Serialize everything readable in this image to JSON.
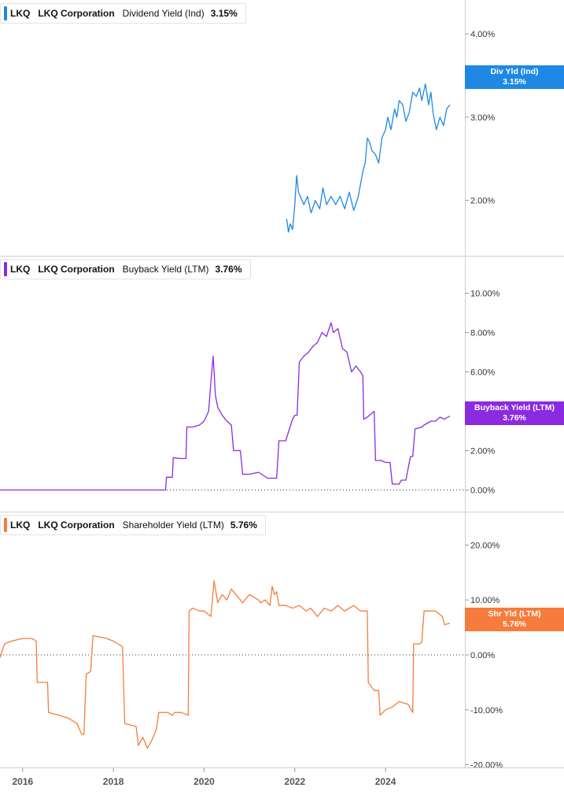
{
  "chart_data": [
    {
      "type": "line",
      "ticker": "LKQ",
      "company": "LKQ Corporation",
      "metric": "Dividend Yield (Ind)",
      "last_value_label": "3.15%",
      "badge": {
        "line1": "Div Yld (Ind)",
        "line2": "3.15%"
      },
      "color": "#1e88e5",
      "ylim": [
        1.6,
        4.2
      ],
      "yticks": [
        2.0,
        3.0,
        4.0
      ],
      "ytick_labels": [
        "2.00%",
        "3.00%",
        "4.00%"
      ],
      "zero_line": false,
      "series": [
        {
          "x": [
            2021.82,
            2021.86,
            2021.9,
            2021.95,
            2022.0,
            2022.04,
            2022.08,
            2022.12,
            2022.2,
            2022.28,
            2022.36,
            2022.45,
            2022.55,
            2022.62,
            2022.7,
            2022.8,
            2022.9,
            2023.0,
            2023.1,
            2023.2,
            2023.3,
            2023.4,
            2023.45,
            2023.5,
            2023.55,
            2023.6,
            2023.65,
            2023.7,
            2023.78,
            2023.85,
            2023.92,
            2024.0,
            2024.05,
            2024.12,
            2024.2,
            2024.25,
            2024.3,
            2024.38,
            2024.45,
            2024.52,
            2024.6,
            2024.68,
            2024.75,
            2024.8,
            2024.88,
            2024.95,
            2025.0,
            2025.05,
            2025.12,
            2025.2,
            2025.28,
            2025.35,
            2025.42
          ],
          "values": [
            1.78,
            1.62,
            1.72,
            1.65,
            1.95,
            2.3,
            2.1,
            2.05,
            1.95,
            2.05,
            1.85,
            2.0,
            1.9,
            2.15,
            1.95,
            2.05,
            1.95,
            2.05,
            1.9,
            2.1,
            1.88,
            2.05,
            2.2,
            2.35,
            2.45,
            2.75,
            2.7,
            2.6,
            2.55,
            2.45,
            2.75,
            2.85,
            3.0,
            2.85,
            3.1,
            3.0,
            3.2,
            3.15,
            2.95,
            3.05,
            3.3,
            3.25,
            3.35,
            3.2,
            3.4,
            3.15,
            3.3,
            3.05,
            2.85,
            3.0,
            2.9,
            3.1,
            3.15
          ]
        }
      ]
    },
    {
      "type": "line",
      "ticker": "LKQ",
      "company": "LKQ Corporation",
      "metric": "Buyback Yield (LTM)",
      "last_value_label": "3.76%",
      "badge": {
        "line1": "Buyback Yield (LTM)",
        "line2": "3.76%"
      },
      "color": "#8a2be2",
      "ylim": [
        -0.3,
        10.5
      ],
      "yticks": [
        0,
        2,
        4,
        6,
        8,
        10
      ],
      "ytick_labels": [
        "0.00%",
        "2.00%",
        "4.00%",
        "6.00%",
        "8.00%",
        "10.00%"
      ],
      "zero_line": true,
      "series": [
        {
          "x": [
            2015.5,
            2016.0,
            2016.5,
            2017.0,
            2017.5,
            2018.0,
            2018.5,
            2019.0,
            2019.15,
            2019.17,
            2019.3,
            2019.32,
            2019.45,
            2019.6,
            2019.62,
            2019.75,
            2019.9,
            2020.0,
            2020.1,
            2020.15,
            2020.2,
            2020.25,
            2020.3,
            2020.4,
            2020.5,
            2020.6,
            2020.65,
            2020.8,
            2020.85,
            2021.0,
            2021.2,
            2021.4,
            2021.45,
            2021.6,
            2021.65,
            2021.8,
            2021.95,
            2022.0,
            2022.05,
            2022.1,
            2022.2,
            2022.3,
            2022.4,
            2022.5,
            2022.6,
            2022.7,
            2022.8,
            2022.85,
            2022.95,
            2023.05,
            2023.15,
            2023.25,
            2023.35,
            2023.45,
            2023.5,
            2023.52,
            2023.6,
            2023.75,
            2023.78,
            2023.9,
            2024.0,
            2024.1,
            2024.15,
            2024.3,
            2024.35,
            2024.45,
            2024.55,
            2024.6,
            2024.65,
            2024.8,
            2024.85,
            2025.0,
            2025.1,
            2025.2,
            2025.3,
            2025.42
          ],
          "values": [
            0.0,
            0.0,
            0.0,
            0.0,
            0.0,
            0.0,
            0.0,
            0.0,
            0.0,
            0.65,
            0.65,
            1.65,
            1.6,
            1.6,
            3.2,
            3.2,
            3.3,
            3.5,
            4.0,
            5.5,
            6.8,
            4.8,
            4.2,
            3.8,
            3.5,
            3.3,
            2.0,
            2.0,
            0.8,
            0.8,
            0.9,
            0.6,
            0.6,
            0.6,
            2.5,
            2.5,
            3.6,
            3.8,
            3.8,
            6.5,
            6.8,
            7.0,
            7.3,
            7.5,
            8.0,
            7.8,
            8.5,
            8.0,
            8.2,
            7.2,
            7.0,
            6.0,
            6.3,
            6.0,
            5.8,
            3.6,
            3.7,
            4.0,
            1.5,
            1.5,
            1.4,
            1.4,
            0.3,
            0.3,
            0.5,
            0.5,
            1.7,
            1.7,
            3.1,
            3.2,
            3.3,
            3.5,
            3.5,
            3.7,
            3.6,
            3.76
          ]
        }
      ]
    },
    {
      "type": "line",
      "ticker": "LKQ",
      "company": "LKQ Corporation",
      "metric": "Shareholder Yield (LTM)",
      "last_value_label": "5.76%",
      "badge": {
        "line1": "Shr Yld (LTM)",
        "line2": "5.76%"
      },
      "color": "#f57c3c",
      "ylim": [
        -20.5,
        21.5
      ],
      "yticks": [
        -20,
        -10,
        0,
        10,
        20
      ],
      "ytick_labels": [
        "-20.00%",
        "-10.00%",
        "0.00%",
        "10.00%",
        "20.00%"
      ],
      "zero_line": true,
      "series": [
        {
          "x": [
            2015.5,
            2015.6,
            2015.75,
            2016.0,
            2016.2,
            2016.3,
            2016.32,
            2016.55,
            2016.57,
            2016.8,
            2017.0,
            2017.2,
            2017.3,
            2017.35,
            2017.4,
            2017.5,
            2017.55,
            2017.85,
            2018.0,
            2018.2,
            2018.25,
            2018.5,
            2018.55,
            2018.65,
            2018.7,
            2018.75,
            2018.85,
            2018.95,
            2019.0,
            2019.1,
            2019.2,
            2019.3,
            2019.35,
            2019.5,
            2019.65,
            2019.67,
            2019.75,
            2019.9,
            2020.0,
            2020.15,
            2020.22,
            2020.3,
            2020.4,
            2020.5,
            2020.6,
            2020.75,
            2020.85,
            2021.0,
            2021.2,
            2021.25,
            2021.35,
            2021.45,
            2021.5,
            2021.55,
            2021.6,
            2021.65,
            2021.8,
            2021.95,
            2022.1,
            2022.25,
            2022.35,
            2022.5,
            2022.65,
            2022.8,
            2022.95,
            2023.1,
            2023.3,
            2023.45,
            2023.55,
            2023.6,
            2023.62,
            2023.75,
            2023.85,
            2023.88,
            2024.0,
            2024.15,
            2024.3,
            2024.5,
            2024.6,
            2024.62,
            2024.75,
            2024.8,
            2024.85,
            2024.95,
            2025.1,
            2025.25,
            2025.3,
            2025.42
          ],
          "values": [
            -0.5,
            2.0,
            2.5,
            3.0,
            3.0,
            2.5,
            -5.0,
            -5.0,
            -10.5,
            -11.0,
            -11.5,
            -12.5,
            -14.5,
            -14.5,
            -3.5,
            -3.0,
            3.5,
            3.0,
            2.5,
            1.5,
            -12.5,
            -13.0,
            -16.5,
            -15.0,
            -16.0,
            -17.0,
            -15.5,
            -13.5,
            -10.5,
            -10.5,
            -10.5,
            -11.0,
            -10.5,
            -10.5,
            -11.0,
            8.0,
            8.5,
            8.0,
            8.0,
            7.0,
            13.5,
            9.5,
            11.0,
            10.0,
            12.0,
            10.5,
            9.5,
            11.0,
            10.0,
            9.5,
            10.0,
            9.0,
            12.5,
            11.0,
            11.5,
            9.0,
            9.0,
            8.5,
            9.0,
            8.0,
            8.5,
            7.0,
            8.5,
            8.0,
            9.0,
            8.0,
            9.0,
            8.0,
            8.0,
            8.0,
            -5.0,
            -6.5,
            -6.5,
            -11.0,
            -10.0,
            -9.5,
            -8.5,
            -9.0,
            -10.5,
            2.0,
            2.0,
            2.3,
            8.0,
            8.0,
            8.0,
            7.0,
            5.5,
            5.76
          ]
        }
      ]
    }
  ],
  "x_axis": {
    "ticks": [
      2016,
      2018,
      2020,
      2022,
      2024
    ],
    "tick_labels": [
      "2016",
      "2018",
      "2020",
      "2022",
      "2024"
    ]
  }
}
